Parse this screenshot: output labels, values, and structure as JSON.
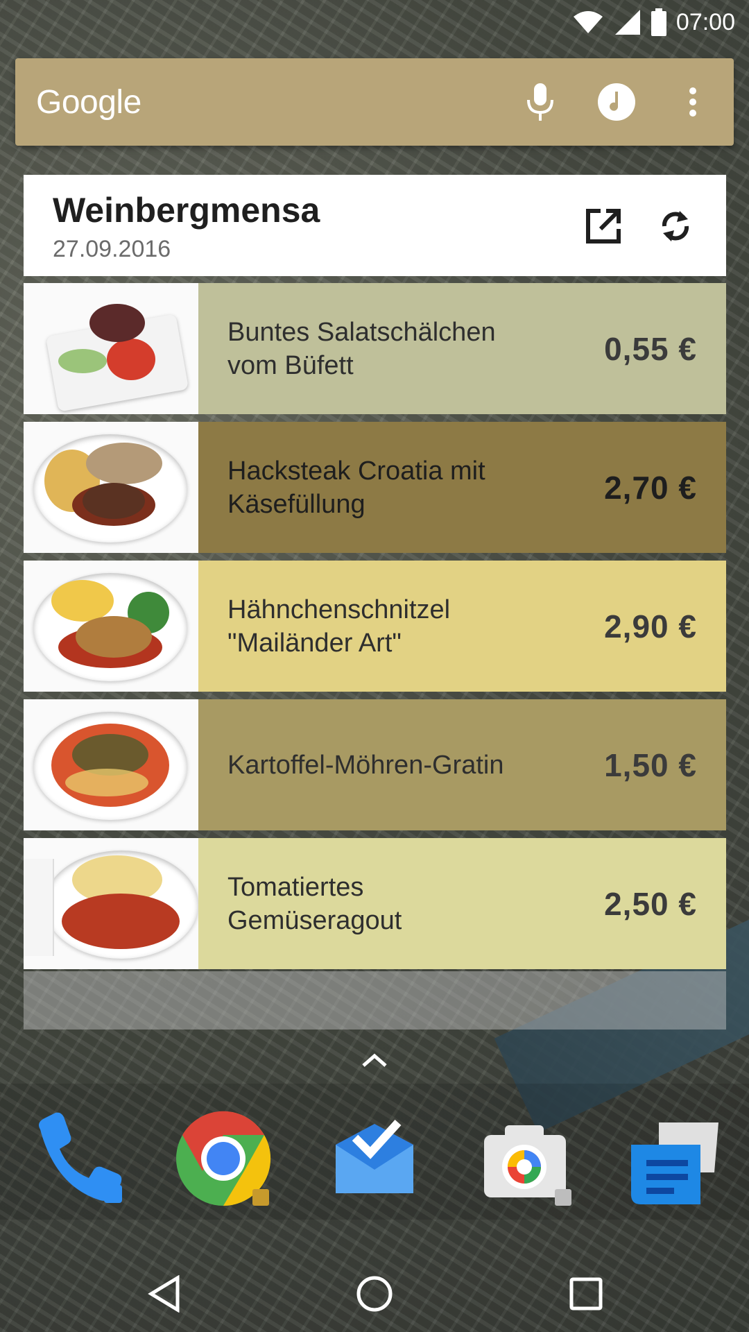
{
  "status_bar": {
    "time": "07:00",
    "icons": [
      "wifi-icon",
      "signal-icon",
      "battery-icon"
    ]
  },
  "search_widget": {
    "logo": "Google",
    "icons": [
      "mic-icon",
      "music-icon",
      "more-vert-icon"
    ],
    "color": "#b8a579"
  },
  "mensa": {
    "title": "Weinbergmensa",
    "date": "27.09.2016",
    "actions": [
      "open-external-icon",
      "refresh-icon"
    ],
    "items": [
      {
        "name": "Buntes Salatschälchen vom Büfett",
        "price": "0,55 €",
        "color": "#bfc09a"
      },
      {
        "name": "Hacksteak Croatia mit Käsefüllung",
        "price": "2,70 €",
        "color": "#8d7a45"
      },
      {
        "name": "Hähnchenschnitzel \"Mailänder Art\"",
        "price": "2,90 €",
        "color": "#e2d284"
      },
      {
        "name": "Kartoffel-Möhren-Gratin",
        "price": "1,50 €",
        "color": "#a89a63"
      },
      {
        "name": "Tomatiertes Gemüseragout",
        "price": "2,50 €",
        "color": "#dcd99c"
      }
    ]
  },
  "dock": {
    "apps": [
      "phone-icon",
      "chrome-icon",
      "inbox-icon",
      "camera-icon",
      "messenger-icon"
    ]
  },
  "nav": [
    "back-icon",
    "home-icon",
    "recents-icon"
  ]
}
